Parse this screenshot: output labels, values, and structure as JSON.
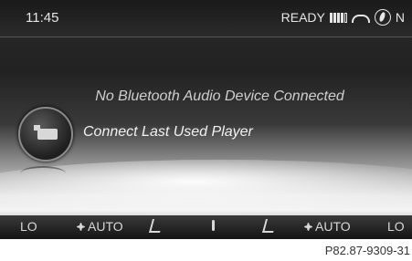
{
  "status": {
    "time": "11:45",
    "ready_label": "READY",
    "heading": "N",
    "icons": [
      "signal-strength-icon",
      "phone-icon",
      "compass-icon"
    ]
  },
  "main": {
    "message": "No Bluetooth Audio Device Connected",
    "connect_label": "Connect Last Used Player",
    "connect_icon": "media-player-icon"
  },
  "climate": {
    "left_temp": "LO",
    "left_fan": "AUTO",
    "right_fan": "AUTO",
    "right_temp": "LO",
    "icons": [
      "fan-icon",
      "seat-airflow-icon",
      "temperature-icon",
      "seat-airflow-icon",
      "fan-icon"
    ]
  },
  "caption": "P82.87-9309-31"
}
